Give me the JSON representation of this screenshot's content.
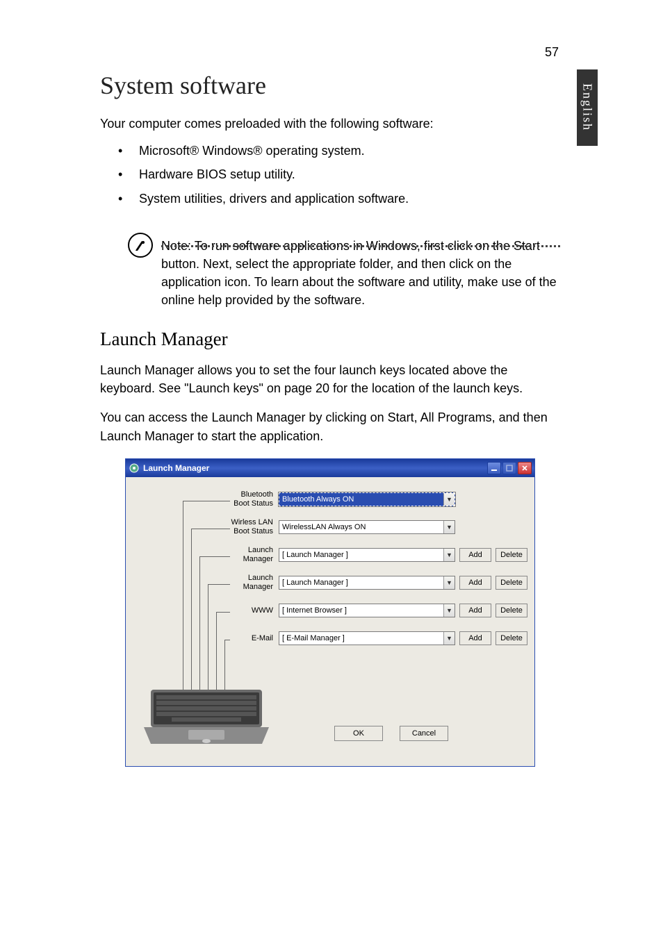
{
  "page_number": "57",
  "side_tab": "English",
  "h1": "System software",
  "intro": "Your computer comes preloaded with the following software:",
  "bullets": [
    "Microsoft® Windows® operating system.",
    "Hardware BIOS setup utility.",
    "System utilities, drivers and application software."
  ],
  "note": "Note: To run software applications in Windows, first click on the Start button. Next, select the appropriate folder, and then click on the application icon. To learn about the software and utility, make use of the online help provided by the software.",
  "h2": "Launch Manager",
  "para1": "Launch Manager allows you to set the four launch keys located above the keyboard.  See \"Launch keys\" on page 20 for the location of the launch keys.",
  "para2": "You can access the Launch Manager by clicking on Start, All Programs, and then Launch Manager to start the application.",
  "lm": {
    "title": "Launch Manager",
    "add": "Add",
    "delete": "Delete",
    "ok": "OK",
    "cancel": "Cancel",
    "rows": [
      {
        "label": "Bluetooth Boot Status",
        "value": "Bluetooth Always ON",
        "buttons": false,
        "selected": true
      },
      {
        "label": "Wirless LAN Boot Status",
        "value": "WirelessLAN Always ON",
        "buttons": false,
        "selected": false
      },
      {
        "label": "Launch Manager",
        "value": "[  Launch Manager  ]",
        "buttons": true,
        "selected": false
      },
      {
        "label": "Launch Manager",
        "value": "[  Launch Manager  ]",
        "buttons": true,
        "selected": false
      },
      {
        "label": "WWW",
        "value": "[  Internet Browser  ]",
        "buttons": true,
        "selected": false
      },
      {
        "label": "E-Mail",
        "value": "[  E-Mail Manager  ]",
        "buttons": true,
        "selected": false
      }
    ]
  }
}
